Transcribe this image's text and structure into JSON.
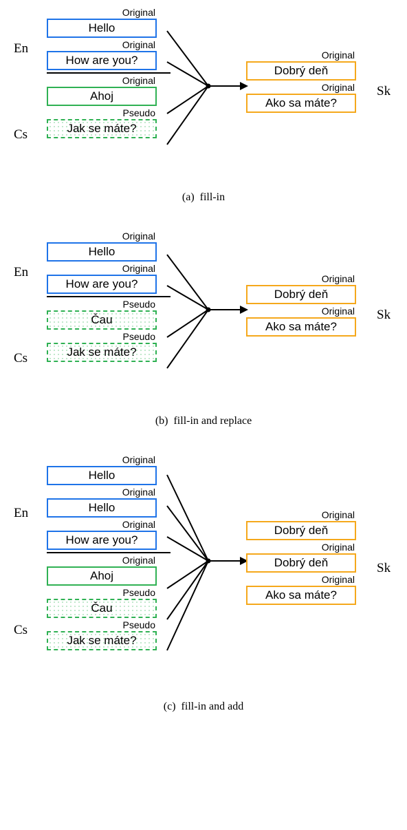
{
  "labels": {
    "original": "Original",
    "pseudo": "Pseudo",
    "en": "En",
    "cs": "Cs",
    "sk": "Sk"
  },
  "text": {
    "hello": "Hello",
    "howareyou": "How are you?",
    "ahoj": "Ahoj",
    "cau": "Čau",
    "jaksemate": "Jak se máte?",
    "dobryden": "Dobrý deň",
    "akosamate": "Ako sa máte?"
  },
  "captions": {
    "a": "(a)  fill-in",
    "b": "(b)  fill-in and replace",
    "c": "(c)  fill-in and add"
  },
  "colors": {
    "blue": "#1e73e8",
    "green": "#2fb153",
    "orange": "#f5a81b"
  },
  "chart_data": {
    "type": "table",
    "title": "Back-translation augmentation strategies (fill-in, fill-in+replace, fill-in+add) mapping English (En) and Czech (Cs) source sentences to Slovak (Sk) targets",
    "panels": [
      {
        "id": "a",
        "caption": "fill-in",
        "left_en": [
          {
            "text": "Hello",
            "tag": "Original"
          },
          {
            "text": "How are you?",
            "tag": "Original"
          }
        ],
        "left_cs": [
          {
            "text": "Ahoj",
            "tag": "Original"
          },
          {
            "text": "Jak se máte?",
            "tag": "Pseudo"
          }
        ],
        "right_sk": [
          {
            "text": "Dobrý deň",
            "tag": "Original"
          },
          {
            "text": "Ako sa máte?",
            "tag": "Original"
          }
        ]
      },
      {
        "id": "b",
        "caption": "fill-in and replace",
        "left_en": [
          {
            "text": "Hello",
            "tag": "Original"
          },
          {
            "text": "How are you?",
            "tag": "Original"
          }
        ],
        "left_cs": [
          {
            "text": "Čau",
            "tag": "Pseudo"
          },
          {
            "text": "Jak se máte?",
            "tag": "Pseudo"
          }
        ],
        "right_sk": [
          {
            "text": "Dobrý deň",
            "tag": "Original"
          },
          {
            "text": "Ako sa máte?",
            "tag": "Original"
          }
        ]
      },
      {
        "id": "c",
        "caption": "fill-in and add",
        "left_en": [
          {
            "text": "Hello",
            "tag": "Original"
          },
          {
            "text": "Hello",
            "tag": "Original"
          },
          {
            "text": "How are you?",
            "tag": "Original"
          }
        ],
        "left_cs": [
          {
            "text": "Ahoj",
            "tag": "Original"
          },
          {
            "text": "Čau",
            "tag": "Pseudo"
          },
          {
            "text": "Jak se máte?",
            "tag": "Pseudo"
          }
        ],
        "right_sk": [
          {
            "text": "Dobrý deň",
            "tag": "Original"
          },
          {
            "text": "Dobrý deň",
            "tag": "Original"
          },
          {
            "text": "Ako sa máte?",
            "tag": "Original"
          }
        ]
      }
    ]
  }
}
